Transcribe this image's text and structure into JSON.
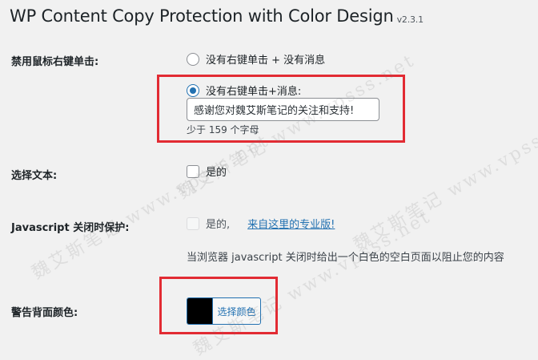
{
  "header": {
    "title": "WP Content Copy Protection with Color Design",
    "version": "v2.3.1"
  },
  "right_click": {
    "label": "禁用鼠标右键单击:",
    "option_no_message": "没有右键单击 + 没有消息",
    "option_with_message": "没有右键单击+消息:",
    "selected": "option_with_message",
    "message_value": "感谢您对魏艾斯笔记的关注和支持!",
    "char_hint": "少于 159 个字母"
  },
  "select_text": {
    "label": "选择文本:",
    "option": "是的",
    "checked": false
  },
  "js_protection": {
    "label": "Javascript 关闭时保护:",
    "option": "是的,",
    "pro_link": "来自这里的专业版!",
    "description": "当浏览器 javascript 关闭时给出一个白色的空白页面以阻止您的内容"
  },
  "alert_bg_color": {
    "label": "警告背面颜色:",
    "button_label": "选择颜色",
    "color": "#000000"
  },
  "colors": {
    "accent": "#2271b1",
    "highlight_box": "#e22b33"
  },
  "watermark": {
    "text": "魏艾斯笔记 www.vpsss.net"
  }
}
